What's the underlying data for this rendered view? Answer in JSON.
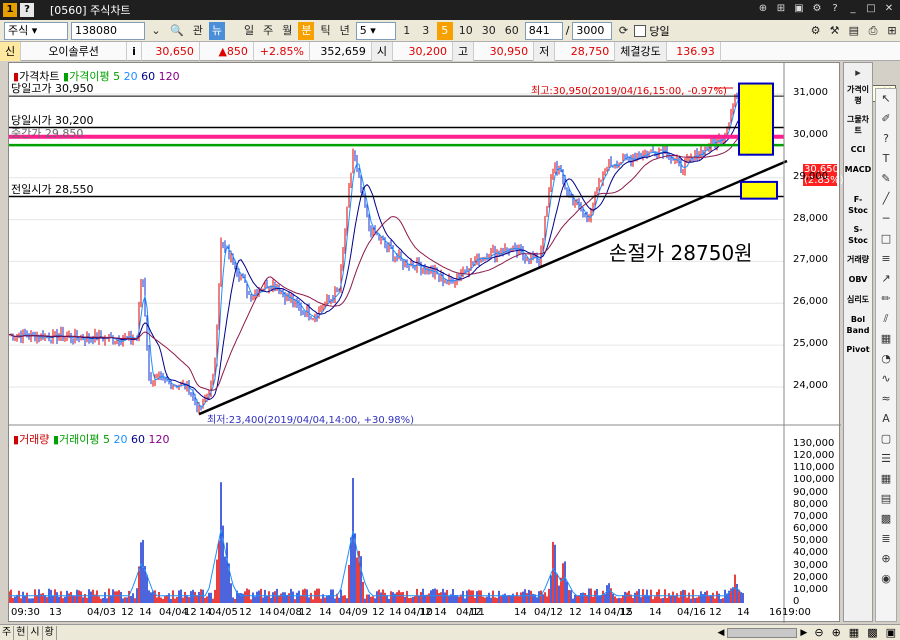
{
  "window": {
    "title": "[0560] 주식차트"
  },
  "toolbar": {
    "market": "주식",
    "code": "138080",
    "btn_gwan": "관",
    "btn_nyu": "뉴",
    "periods": [
      "일",
      "주",
      "월",
      "분",
      "틱",
      "년"
    ],
    "period_selected": "분",
    "interval_value": "5",
    "quick_intervals": [
      "1",
      "3",
      "5",
      "10",
      "30",
      "60"
    ],
    "quick_selected": "5",
    "count_shown": "841",
    "count_total": "3000",
    "today_label": "당일"
  },
  "quote": {
    "badge": "신",
    "name": "오이솔루션",
    "info_icon": "i",
    "price": "30,650",
    "change": "▲850",
    "rate": "+2.85%",
    "volume": "352,659",
    "open_label": "시",
    "open": "30,200",
    "high_label": "고",
    "high": "30,950",
    "low_label": "저",
    "low": "28,750",
    "strength_label": "체결강도",
    "strength": "136.93",
    "interval_badge": "5분"
  },
  "legend": {
    "price_title": "가격차트",
    "ma_title": "가격이평",
    "ma_periods": [
      "5",
      "20",
      "60",
      "120"
    ],
    "volume_title": "거래량",
    "vol_ma_title": "거래이평",
    "vol_ma_periods": [
      "5",
      "20",
      "60",
      "120"
    ]
  },
  "annotations": {
    "today_high": "당일고가 30,950",
    "today_open": "당일시가 30,200",
    "prev_close": "전일시가 28,550",
    "hidden_label": "중간가 29,850",
    "max_label": "최고:30,950(2019/04/16,15:00, -0.97%)",
    "min_label": "최저:23,400(2019/04/04,14:00, +30.98%)",
    "stoploss": "손절가 28750원",
    "price_tag_value": "30,650",
    "price_tag_rate": "(2.85%)"
  },
  "price_axis": [
    "31,000",
    "30,000",
    "29,000",
    "28,000",
    "27,000",
    "26,000",
    "25,000",
    "24,000"
  ],
  "volume_axis": [
    "130,000",
    "120,000",
    "110,000",
    "100,000",
    "90,000",
    "80,000",
    "70,000",
    "60,000",
    "50,000",
    "40,000",
    "30,000",
    "20,000",
    "10,000",
    "0"
  ],
  "time_axis": [
    "09:30",
    "13",
    "04/03",
    "12",
    "14",
    "04/04",
    "12",
    "14",
    "04/05",
    "12",
    "14",
    "04/08",
    "12",
    "14",
    "04/09",
    "12",
    "14",
    "04/10",
    "12",
    "14",
    "04/11",
    "12",
    "14",
    "04/12",
    "12",
    "14",
    "04/15",
    "12",
    "14",
    "04/16",
    "12",
    "14",
    "16",
    "19:00"
  ],
  "right_tools": [
    "가격이평",
    "그물차트",
    "CCI",
    "MACD",
    "F-Stoc",
    "S-Stoc",
    "거래량",
    "OBV",
    "심리도",
    "Bol Band",
    "Pivot"
  ],
  "bottom_tabs": [
    "주",
    "현",
    "시",
    "황"
  ],
  "colors": {
    "titlebar": "#1f1f1f",
    "accent": "#f7a100",
    "up": "#e00000",
    "magenta": "#ff1f8e",
    "green": "#00a000",
    "box_fill": "#ffff00",
    "box_border": "#0000c0"
  }
}
